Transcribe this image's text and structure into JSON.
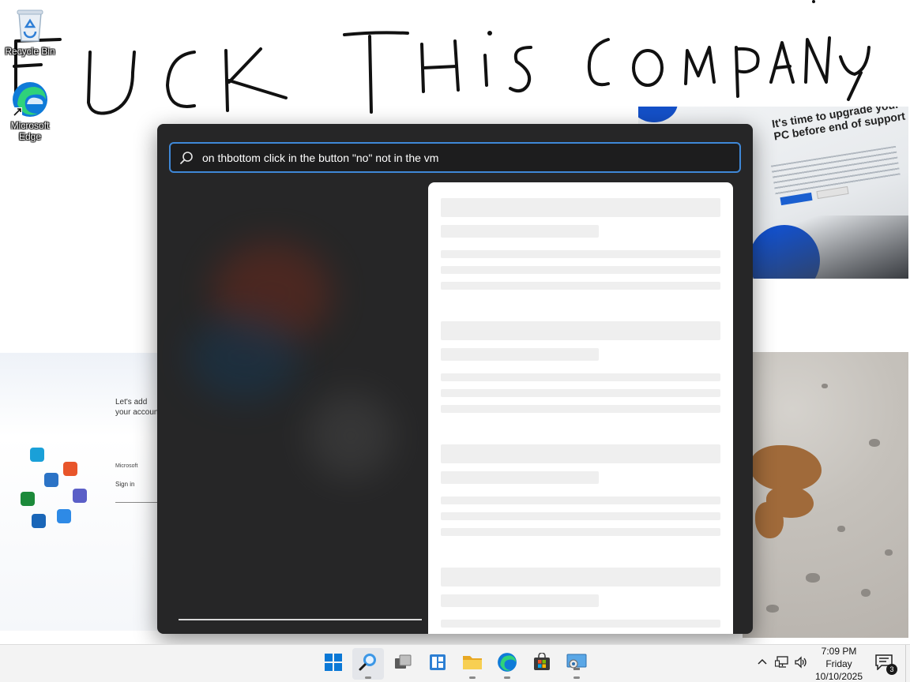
{
  "desktop": {
    "icons": [
      {
        "label": "Recycle Bin",
        "icon": "recycle-bin-icon"
      },
      {
        "label": "Microsoft Edge",
        "icon": "edge-icon"
      }
    ],
    "handwriting": "FUCK THIS COMPANY"
  },
  "wallpaper_photos": {
    "upgrade_headline": "It's time to upgrade your PC before end of support",
    "setup_title": "Let's add your account",
    "setup_brand": "Microsoft",
    "setup_signin": "Sign in"
  },
  "search": {
    "query": "on thbottom click in the button \"no\" not in the vm",
    "icon": "search-icon"
  },
  "taskbar": {
    "buttons": [
      {
        "name": "start",
        "icon": "windows-start-icon"
      },
      {
        "name": "search",
        "icon": "search-icon",
        "active": true
      },
      {
        "name": "task-view",
        "icon": "task-view-icon"
      },
      {
        "name": "widgets",
        "icon": "widgets-icon"
      },
      {
        "name": "file-explorer",
        "icon": "folder-icon"
      },
      {
        "name": "edge",
        "icon": "edge-icon"
      },
      {
        "name": "store",
        "icon": "store-icon"
      },
      {
        "name": "remote-app",
        "icon": "monitor-icon"
      }
    ],
    "tray": {
      "chevron": "chevron-up-icon",
      "network": "network-icon",
      "volume": "volume-icon"
    },
    "clock": {
      "time": "7:09 PM",
      "day": "Friday",
      "date": "10/10/2025"
    },
    "notifications": {
      "count": "3",
      "icon": "notification-icon"
    }
  },
  "colors": {
    "accent": "#3f88d8",
    "panel_bg": "#262627",
    "taskbar_bg": "#f3f3f3"
  }
}
